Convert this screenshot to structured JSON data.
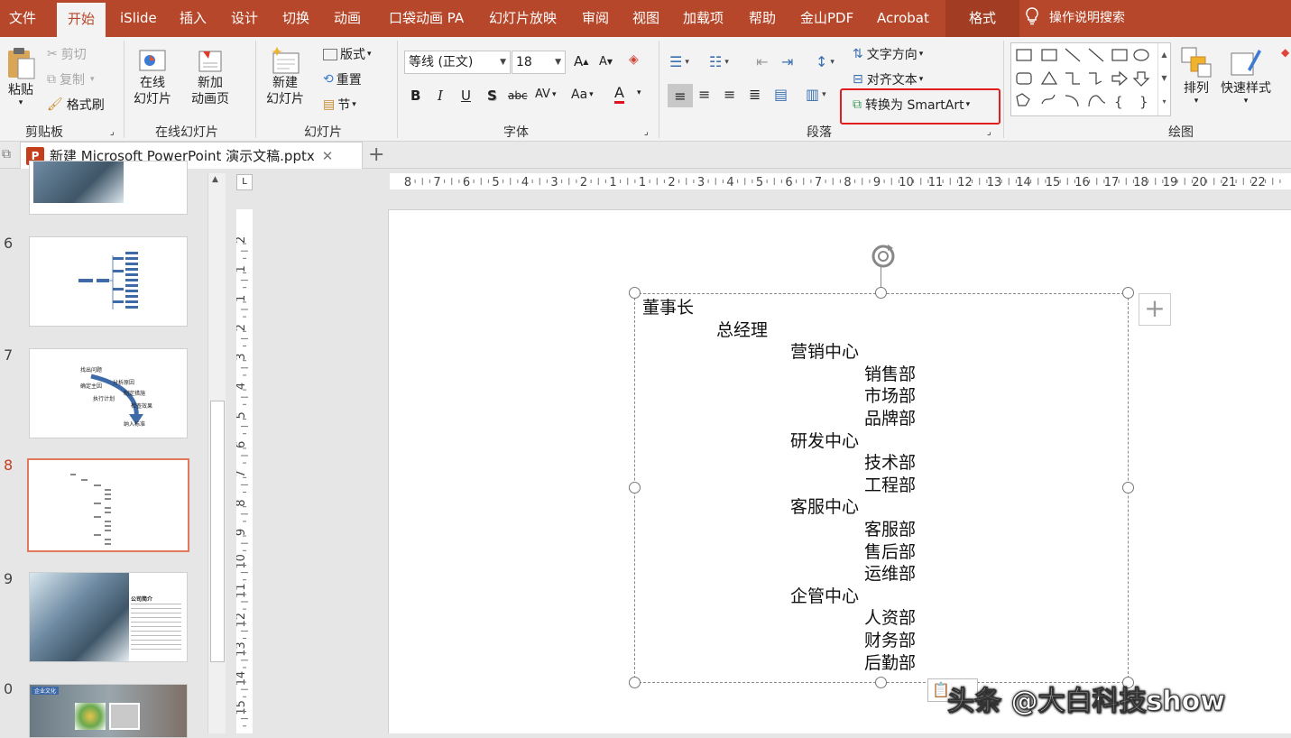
{
  "menu": {
    "tabs": [
      "文件",
      "开始",
      "iSlide",
      "插入",
      "设计",
      "切换",
      "动画",
      "口袋动画 PA",
      "幻灯片放映",
      "审阅",
      "视图",
      "加载项",
      "帮助",
      "金山PDF",
      "Acrobat"
    ],
    "format_tab": "格式",
    "search": "操作说明搜索"
  },
  "ribbon": {
    "clipboard": {
      "paste": "粘贴",
      "cut": "剪切",
      "copy": "复制",
      "format_painter": "格式刷",
      "label": "剪贴板"
    },
    "online": {
      "online_slides_1": "在线",
      "online_slides_2": "幻灯片",
      "new_anim_1": "新加",
      "new_anim_2": "动画页",
      "label": "在线幻灯片"
    },
    "slides": {
      "new_slide_1": "新建",
      "new_slide_2": "幻灯片",
      "layout": "版式",
      "reset": "重置",
      "section": "节",
      "label": "幻灯片"
    },
    "font": {
      "font_name": "等线 (正文)",
      "font_size": "18",
      "grow": "A",
      "shrink": "A",
      "bold": "B",
      "italic": "I",
      "underline": "U",
      "shadow": "S",
      "strike": "abc",
      "spacing": "AV",
      "case": "Aa",
      "color": "A",
      "label": "字体"
    },
    "paragraph": {
      "text_direction": "文字方向",
      "align_text": "对齐文本",
      "smartart": "转换为 SmartArt",
      "label": "段落"
    },
    "drawing": {
      "arrange": "排列",
      "quick_styles": "快速样式",
      "label": "绘图"
    }
  },
  "doc_tab": {
    "title": "新建 Microsoft PowerPoint 演示文稿.pptx"
  },
  "thumbnails": {
    "numbers": [
      "6",
      "7",
      "8",
      "9",
      "0"
    ],
    "slide7": [
      "找出问题",
      "确定主因",
      "分析原因",
      "执行计划",
      "制定措施",
      "检查效果",
      "纳入标准"
    ],
    "slide9_title": "公司简介",
    "slide10_tag": "企业文化"
  },
  "ruler": {
    "h": [
      "8",
      "7",
      "6",
      "5",
      "4",
      "3",
      "2",
      "1",
      "1",
      "2",
      "3",
      "4",
      "5",
      "6",
      "7",
      "8",
      "9",
      "10",
      "11",
      "12",
      "13",
      "14",
      "15",
      "16",
      "17",
      "18",
      "19",
      "20",
      "21",
      "22"
    ],
    "v": [
      "2",
      "1",
      "1",
      "2",
      "3",
      "4",
      "5",
      "6",
      "7",
      "8",
      "9",
      "10",
      "11",
      "12",
      "13",
      "14",
      "15"
    ]
  },
  "outline": [
    {
      "text": "董事长",
      "level": 0
    },
    {
      "text": "总经理",
      "level": 1
    },
    {
      "text": "营销中心",
      "level": 2
    },
    {
      "text": "销售部",
      "level": 3
    },
    {
      "text": "市场部",
      "level": 3
    },
    {
      "text": "品牌部",
      "level": 3
    },
    {
      "text": "研发中心",
      "level": 2
    },
    {
      "text": "技术部",
      "level": 3
    },
    {
      "text": "工程部",
      "level": 3
    },
    {
      "text": "客服中心",
      "level": 2
    },
    {
      "text": "客服部",
      "level": 3
    },
    {
      "text": "售后部",
      "level": 3
    },
    {
      "text": "运维部",
      "level": 3
    },
    {
      "text": "企管中心",
      "level": 2
    },
    {
      "text": "人资部",
      "level": 3
    },
    {
      "text": "财务部",
      "level": 3
    },
    {
      "text": "后勤部",
      "level": 3
    }
  ],
  "watermark": "头条 @大白科技show"
}
